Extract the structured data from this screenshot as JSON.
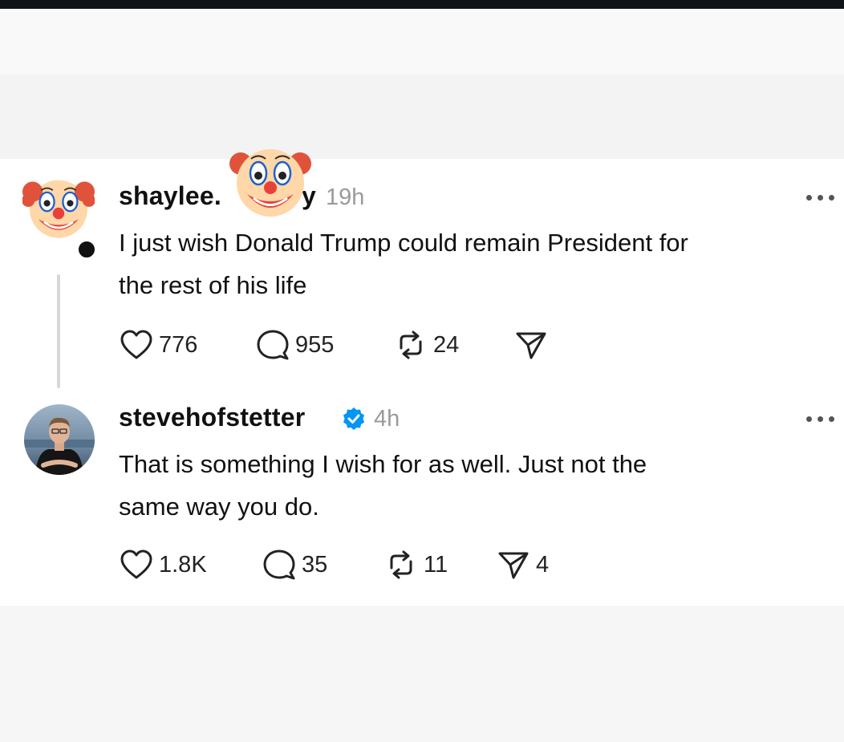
{
  "post": {
    "username": "shaylee.",
    "username_tail": "y",
    "time": "19h",
    "text_line1": "I just wish Donald Trump could remain President for",
    "text_line2": "the rest of his life",
    "likes": "776",
    "replies": "955",
    "reposts": "24",
    "shares": ""
  },
  "reply": {
    "username": "stevehofstetter",
    "verified": true,
    "time": "4h",
    "text_line1": "That is something I wish for as well. Just not the",
    "text_line2": "same way you do.",
    "likes": "1.8K",
    "replies": "35",
    "reposts": "11",
    "shares": "4"
  },
  "icons": {
    "like": "heart-icon",
    "reply": "comment-bubble-icon",
    "repost": "repost-arrows-icon",
    "share": "paper-plane-icon",
    "more": "more-options-icon",
    "verified": "verified-badge-icon",
    "overlay": "clown-face-emoji-icon"
  },
  "colors": {
    "verified_blue": "#0095f6",
    "muted_text": "#9a9a9a",
    "clown_red": "#e8413a",
    "clown_hair": "#e0533a"
  }
}
